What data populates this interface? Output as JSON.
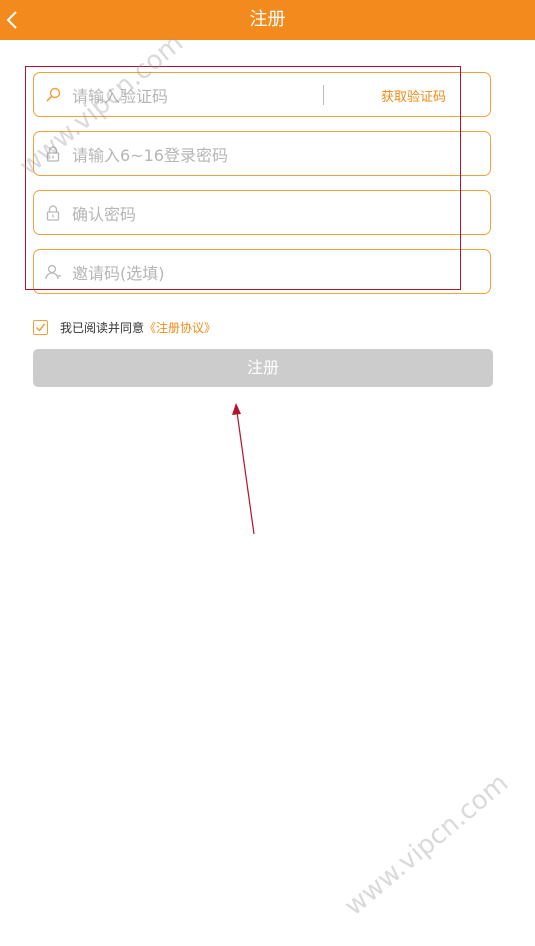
{
  "header": {
    "title": "注册",
    "back_icon": "chevron-left-icon",
    "color": "#f28a1d"
  },
  "form": {
    "code_field": {
      "placeholder": "请输入验证码",
      "icon": "search-icon",
      "action_label": "获取验证码"
    },
    "password_field": {
      "placeholder": "请输入6~16登录密码",
      "icon": "lock-icon"
    },
    "confirm_field": {
      "placeholder": "确认密码",
      "icon": "lock-icon"
    },
    "invite_field": {
      "placeholder": "邀请码(选填)",
      "icon": "user-icon"
    },
    "agreement": {
      "checked": true,
      "text": "我已阅读并同意",
      "link": "《注册协议》"
    },
    "submit_label": "注册"
  },
  "watermarks": [
    "www.vipcn.com",
    "www.vipcn.com"
  ],
  "colors": {
    "accent": "#ef8b17",
    "annotation": "#b3142d",
    "disabled": "#cccccc"
  }
}
